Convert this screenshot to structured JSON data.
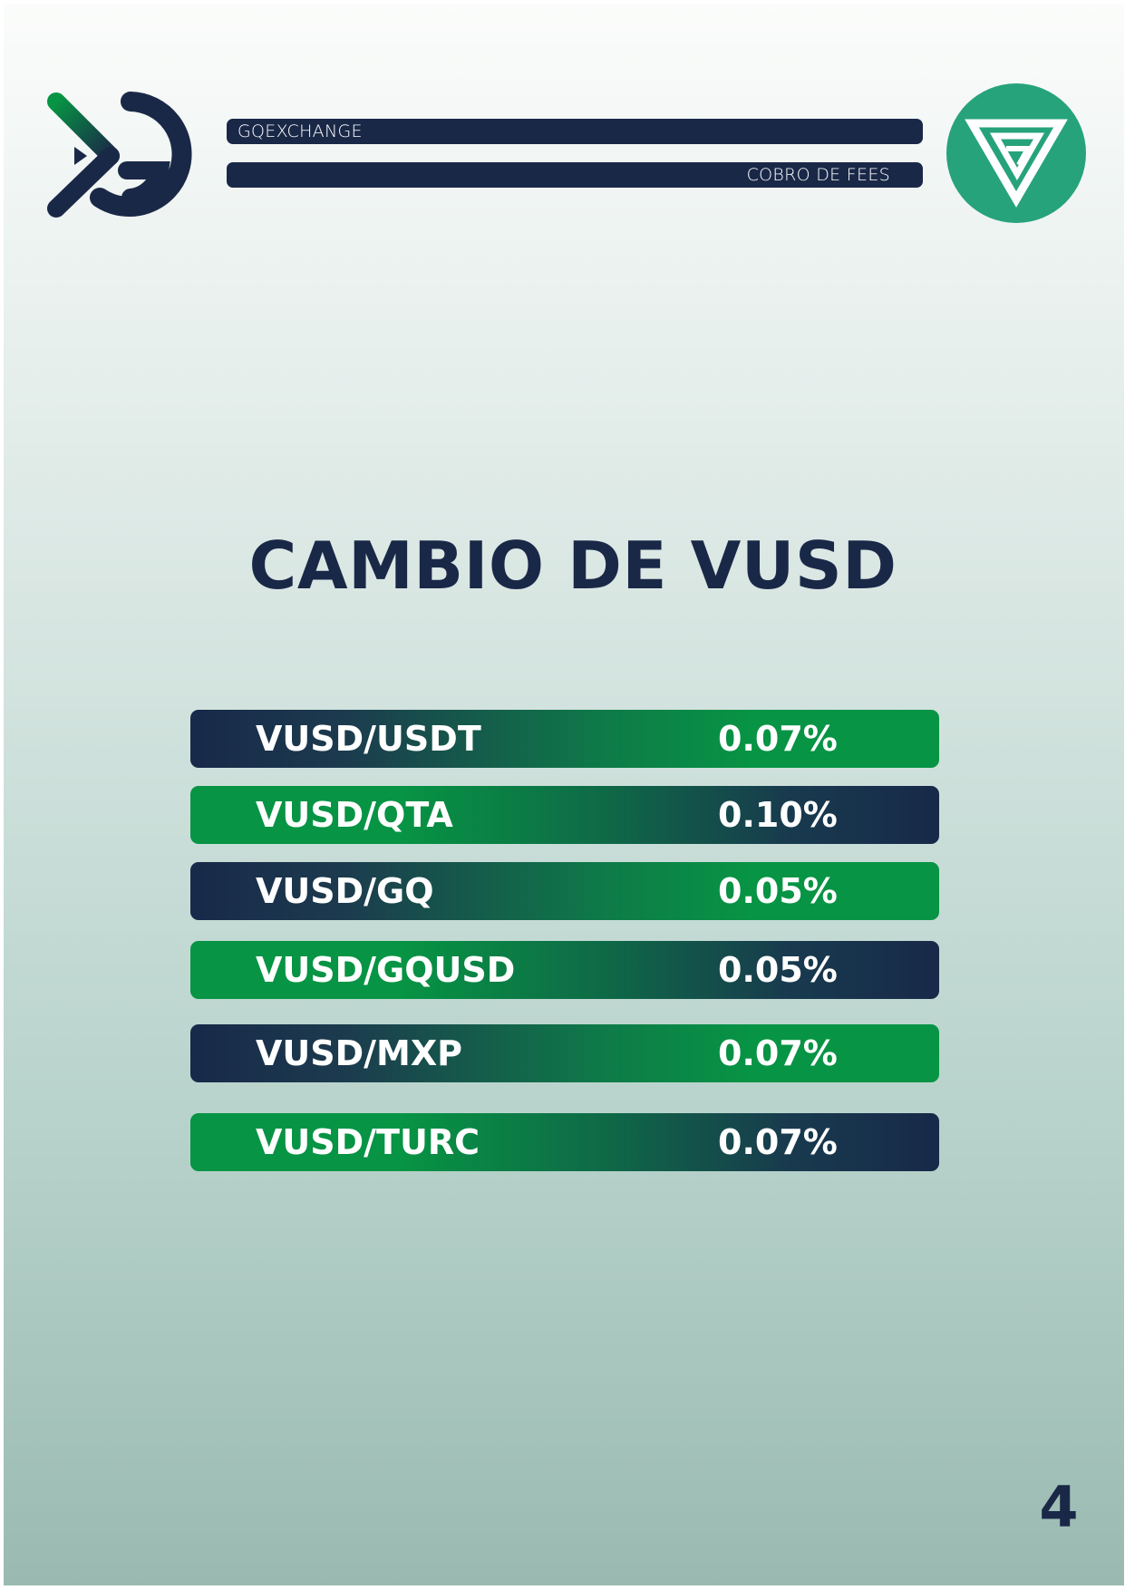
{
  "header": {
    "brand_label": "GQEXCHANGE",
    "section_label": "COBRO DE FEES"
  },
  "icons": {
    "left_logo": "gq-logo-icon",
    "right_logo": "v-triangle-logo-icon"
  },
  "colors": {
    "navy": "#1a2848",
    "green": "#079444",
    "teal_logo": "#27a37c"
  },
  "main": {
    "title": "CAMBIO DE VUSD",
    "fees": [
      {
        "pair": "VUSD/USDT",
        "fee": "0.07%",
        "style": "navy-first"
      },
      {
        "pair": "VUSD/QTA",
        "fee": "0.10%",
        "style": "green-first"
      },
      {
        "pair": "VUSD/GQ",
        "fee": "0.05%",
        "style": "navy-first"
      },
      {
        "pair": "VUSD/GQUSD",
        "fee": "0.05%",
        "style": "green-first"
      },
      {
        "pair": "VUSD/MXP",
        "fee": "0.07%",
        "style": "navy-first"
      },
      {
        "pair": "VUSD/TURC",
        "fee": "0.07%",
        "style": "green-first"
      }
    ]
  },
  "footer": {
    "page_number": "4"
  }
}
